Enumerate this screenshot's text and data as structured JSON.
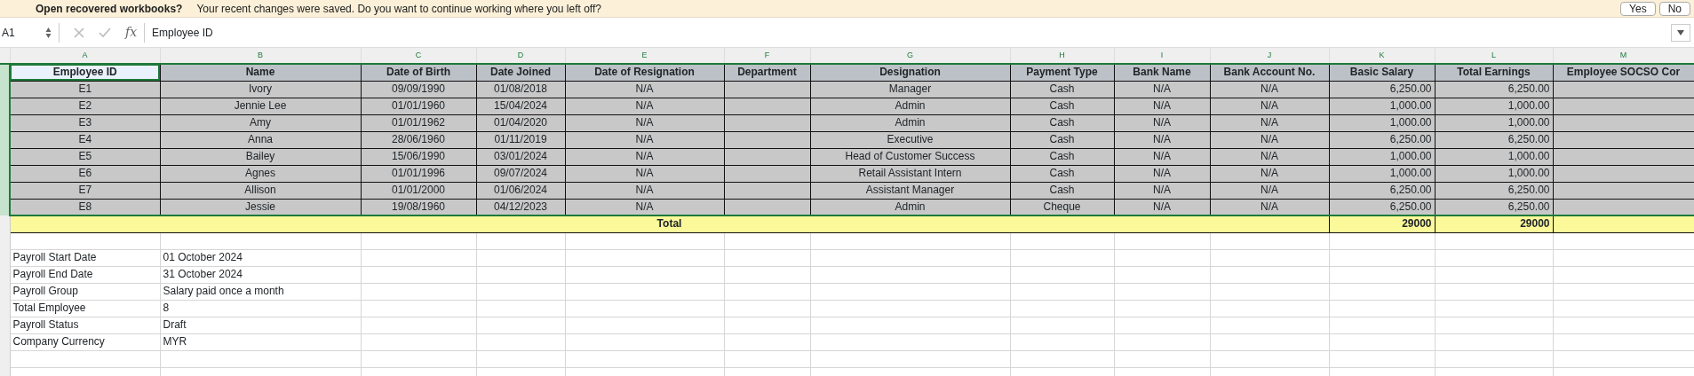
{
  "notification": {
    "title": "Open recovered workbooks?",
    "message": "Your recent changes were saved. Do you want to continue working where you left off?",
    "buttons": [
      "Yes",
      "No"
    ]
  },
  "formula_bar": {
    "cell_ref": "A1",
    "function_label": "fx",
    "value": "Employee ID"
  },
  "columns": [
    {
      "letter": "A",
      "highlighted": true
    },
    {
      "letter": "B",
      "highlighted": true
    },
    {
      "letter": "C",
      "highlighted": true
    },
    {
      "letter": "D",
      "highlighted": true
    },
    {
      "letter": "E",
      "highlighted": true
    },
    {
      "letter": "F",
      "highlighted": true
    },
    {
      "letter": "G",
      "highlighted": true
    },
    {
      "letter": "H",
      "highlighted": true
    },
    {
      "letter": "I",
      "highlighted": true
    },
    {
      "letter": "J",
      "highlighted": true
    },
    {
      "letter": "K",
      "highlighted": true
    },
    {
      "letter": "L",
      "highlighted": true
    },
    {
      "letter": "M",
      "highlighted": true
    }
  ],
  "header_row": [
    {
      "label": "Employee ID",
      "selected": true
    },
    {
      "label": "Name",
      "selected": false
    },
    {
      "label": "Date of Birth",
      "selected": false
    },
    {
      "label": "Date Joined",
      "selected": false
    },
    {
      "label": "Date of Resignation",
      "selected": false
    },
    {
      "label": "Department",
      "selected": false
    },
    {
      "label": "Designation",
      "selected": false
    },
    {
      "label": "Payment Type",
      "selected": false
    },
    {
      "label": "Bank Name",
      "selected": false
    },
    {
      "label": "Bank Account No.",
      "selected": false
    },
    {
      "label": "Basic Salary",
      "selected": false
    },
    {
      "label": "Total Earnings",
      "selected": false
    },
    {
      "label": "Employee SOCSO Cor",
      "selected": false
    }
  ],
  "rows": [
    {
      "A": "E1",
      "B": "Ivory",
      "C": "09/09/1990",
      "D": "01/08/2018",
      "E": "N/A",
      "G": "Manager",
      "H": "Cash",
      "I": "N/A",
      "J": "N/A",
      "K": "6,250.00",
      "L": "6,250.00"
    },
    {
      "A": "E2",
      "B": "Jennie Lee",
      "C": "01/01/1960",
      "D": "15/04/2024",
      "E": "N/A",
      "G": "Admin",
      "H": "Cash",
      "I": "N/A",
      "J": "N/A",
      "K": "1,000.00",
      "L": "1,000.00"
    },
    {
      "A": "E3",
      "B": "Amy",
      "C": "01/01/1962",
      "D": "01/04/2020",
      "E": "N/A",
      "G": "Admin",
      "H": "Cash",
      "I": "N/A",
      "J": "N/A",
      "K": "1,000.00",
      "L": "1,000.00"
    },
    {
      "A": "E4",
      "B": "Anna",
      "C": "28/06/1960",
      "D": "01/11/2019",
      "E": "N/A",
      "G": "Executive",
      "H": "Cash",
      "I": "N/A",
      "J": "N/A",
      "K": "6,250.00",
      "L": "6,250.00"
    },
    {
      "A": "E5",
      "B": "Bailey",
      "C": "15/06/1990",
      "D": "03/01/2024",
      "E": "N/A",
      "G": "Head of Customer Success",
      "H": "Cash",
      "I": "N/A",
      "J": "N/A",
      "K": "1,000.00",
      "L": "1,000.00"
    },
    {
      "A": "E6",
      "B": "Agnes",
      "C": "01/01/1996",
      "D": "09/07/2024",
      "E": "N/A",
      "G": "Retail Assistant Intern",
      "H": "Cash",
      "I": "N/A",
      "J": "N/A",
      "K": "1,000.00",
      "L": "1,000.00"
    },
    {
      "A": "E7",
      "B": "Allison",
      "C": "01/01/2000",
      "D": "01/06/2024",
      "E": "N/A",
      "G": "Assistant Manager",
      "H": "Cash",
      "I": "N/A",
      "J": "N/A",
      "K": "6,250.00",
      "L": "6,250.00"
    },
    {
      "A": "E8",
      "B": "Jessie",
      "C": "19/08/1960",
      "D": "04/12/2023",
      "E": "N/A",
      "G": "Admin",
      "H": "Cheque",
      "I": "N/A",
      "J": "N/A",
      "K": "6,250.00",
      "L": "6,250.00"
    }
  ],
  "total_row": {
    "label": "Total",
    "K": "29000",
    "L": "29000"
  },
  "summary": [
    {
      "label": "Payroll Start Date",
      "value": "01 October 2024"
    },
    {
      "label": "Payroll End Date",
      "value": "31 October 2024"
    },
    {
      "label": "Payroll Group",
      "value": "Salary paid once a month"
    },
    {
      "label": "Total Employee",
      "value": "8"
    },
    {
      "label": "Payroll Status",
      "value": "Draft"
    },
    {
      "label": "Company Currency",
      "value": "MYR"
    }
  ]
}
